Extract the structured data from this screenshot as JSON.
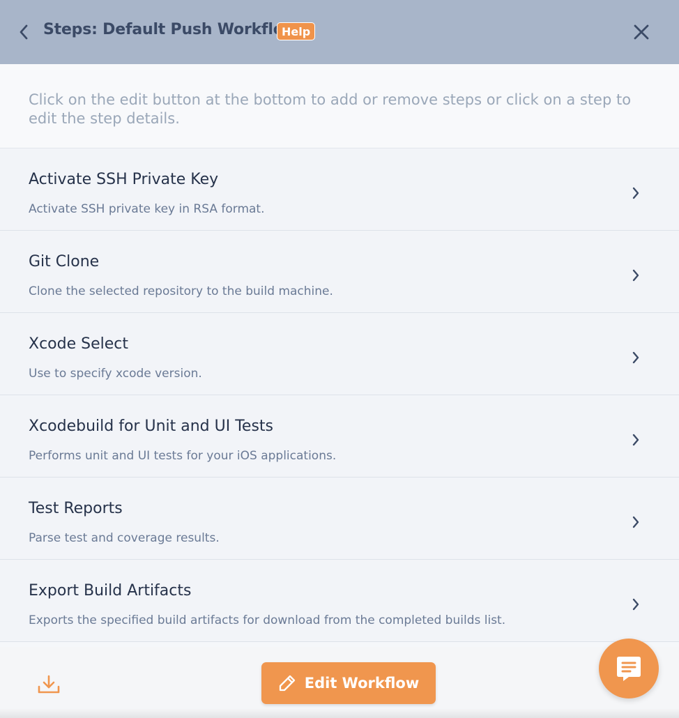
{
  "header": {
    "back_icon": "chevron-left-icon",
    "title": "Steps: Default Push Workflow",
    "help_label": "Help",
    "close_icon": "close-icon"
  },
  "intro": {
    "text": "Click on the edit button at the bottom to add or remove steps or click on a step to edit the step details."
  },
  "steps": [
    {
      "title": "Activate SSH Private Key",
      "description": "Activate SSH private key in RSA format."
    },
    {
      "title": "Git Clone",
      "description": "Clone the selected repository to the build machine."
    },
    {
      "title": "Xcode Select",
      "description": "Use to specify xcode version."
    },
    {
      "title": "Xcodebuild for Unit and UI Tests",
      "description": "Performs unit and UI tests for your iOS applications."
    },
    {
      "title": "Test Reports",
      "description": "Parse test and coverage results."
    },
    {
      "title": "Export Build Artifacts",
      "description": "Exports the specified build artifacts for download from the completed builds list."
    }
  ],
  "footer": {
    "download_icon": "download-icon",
    "edit_label": "Edit Workflow",
    "edit_icon": "pencil-icon",
    "chat_icon": "chat-icon"
  },
  "colors": {
    "header_bg": "#a8b5c9",
    "accent": "#f0964e",
    "title_text": "#3b4a66"
  }
}
